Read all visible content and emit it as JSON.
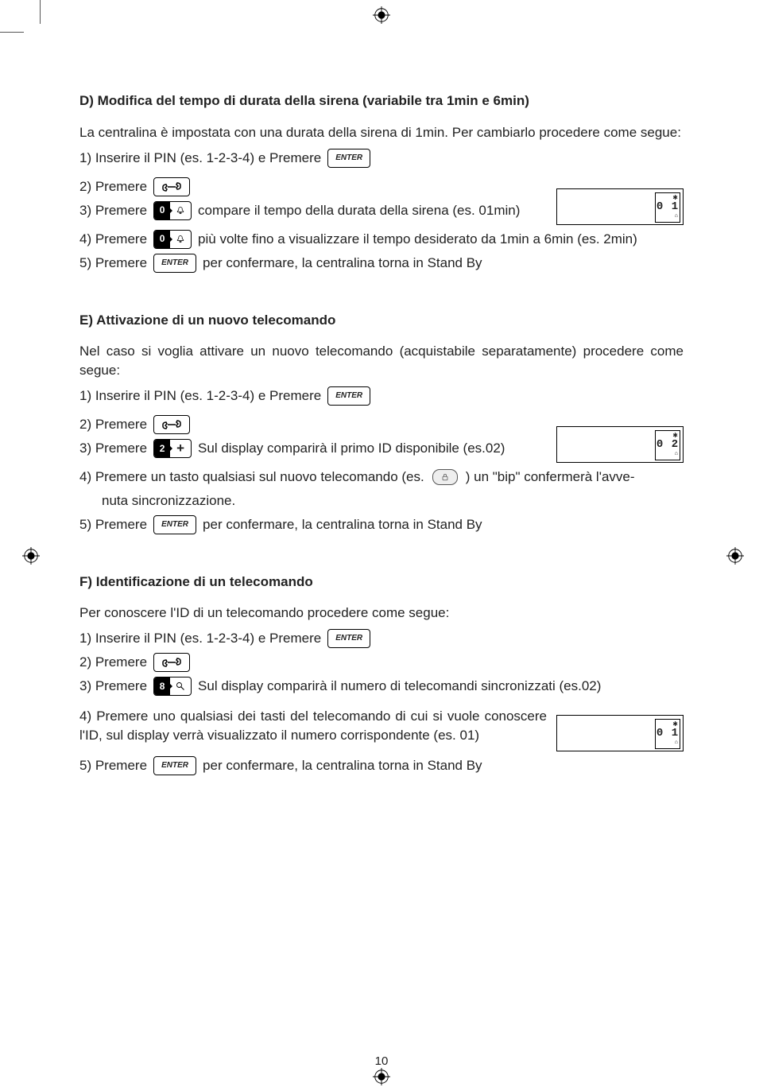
{
  "page_number": "10",
  "keys": {
    "enter": "ENTER",
    "num0": "0",
    "num2": "2",
    "num8": "8"
  },
  "displays": {
    "d01": "0 1",
    "d02": "0 2",
    "f01": "0 1"
  },
  "sectionD": {
    "title": "D) Modifica del tempo di durata della sirena (variabile tra 1min e  6min)",
    "intro": "La centralina è impostata con una durata della sirena di 1min. Per cambiarlo procedere come segue:",
    "s1a": "1) Inserire il PIN (es. 1-2-3-4) e Premere",
    "s2": "2) Premere",
    "s3a": "3) Premere",
    "s3b": "compare il tempo della durata della sirena (es. 01min)",
    "s4a": "4) Premere",
    "s4b": "più volte fino a visualizzare il tempo desiderato da 1min a 6min (es. 2min)",
    "s5a": "5) Premere",
    "s5b": "per confermare, la centralina torna in Stand By"
  },
  "sectionE": {
    "title": "E) Attivazione di un nuovo telecomando",
    "intro": "Nel caso si voglia attivare un nuovo telecomando (acquistabile separatamente) procedere come segue:",
    "s1a": "1) Inserire il PIN (es. 1-2-3-4) e Premere",
    "s2": "2) Premere",
    "s3a": "3) Premere",
    "s3b": "Sul display comparirà il primo ID disponibile (es.02)",
    "s4a": "4) Premere un tasto qualsiasi sul nuovo telecomando (es.",
    "s4b": ") un \"bip\" confermerà l'avve-",
    "s4c": "nuta sincronizzazione.",
    "s5a": "5) Premere",
    "s5b": "per confermare, la centralina torna in Stand By"
  },
  "sectionF": {
    "title": "F) Identificazione di un telecomando",
    "intro": "Per conoscere l'ID di un telecomando procedere come segue:",
    "s1a": "1) Inserire il PIN (es. 1-2-3-4) e Premere",
    "s2": "2) Premere",
    "s3a": "3) Premere",
    "s3b": "Sul display comparirà il numero di telecomandi sincronizzati (es.02)",
    "s4": "4) Premere uno qualsiasi dei tasti del telecomando di cui si vuole conoscere l'ID, sul display verrà visualizzato il numero corrispondente (es. 01)",
    "s5a": "5) Premere",
    "s5b": "per confermare, la centralina torna in Stand By"
  }
}
